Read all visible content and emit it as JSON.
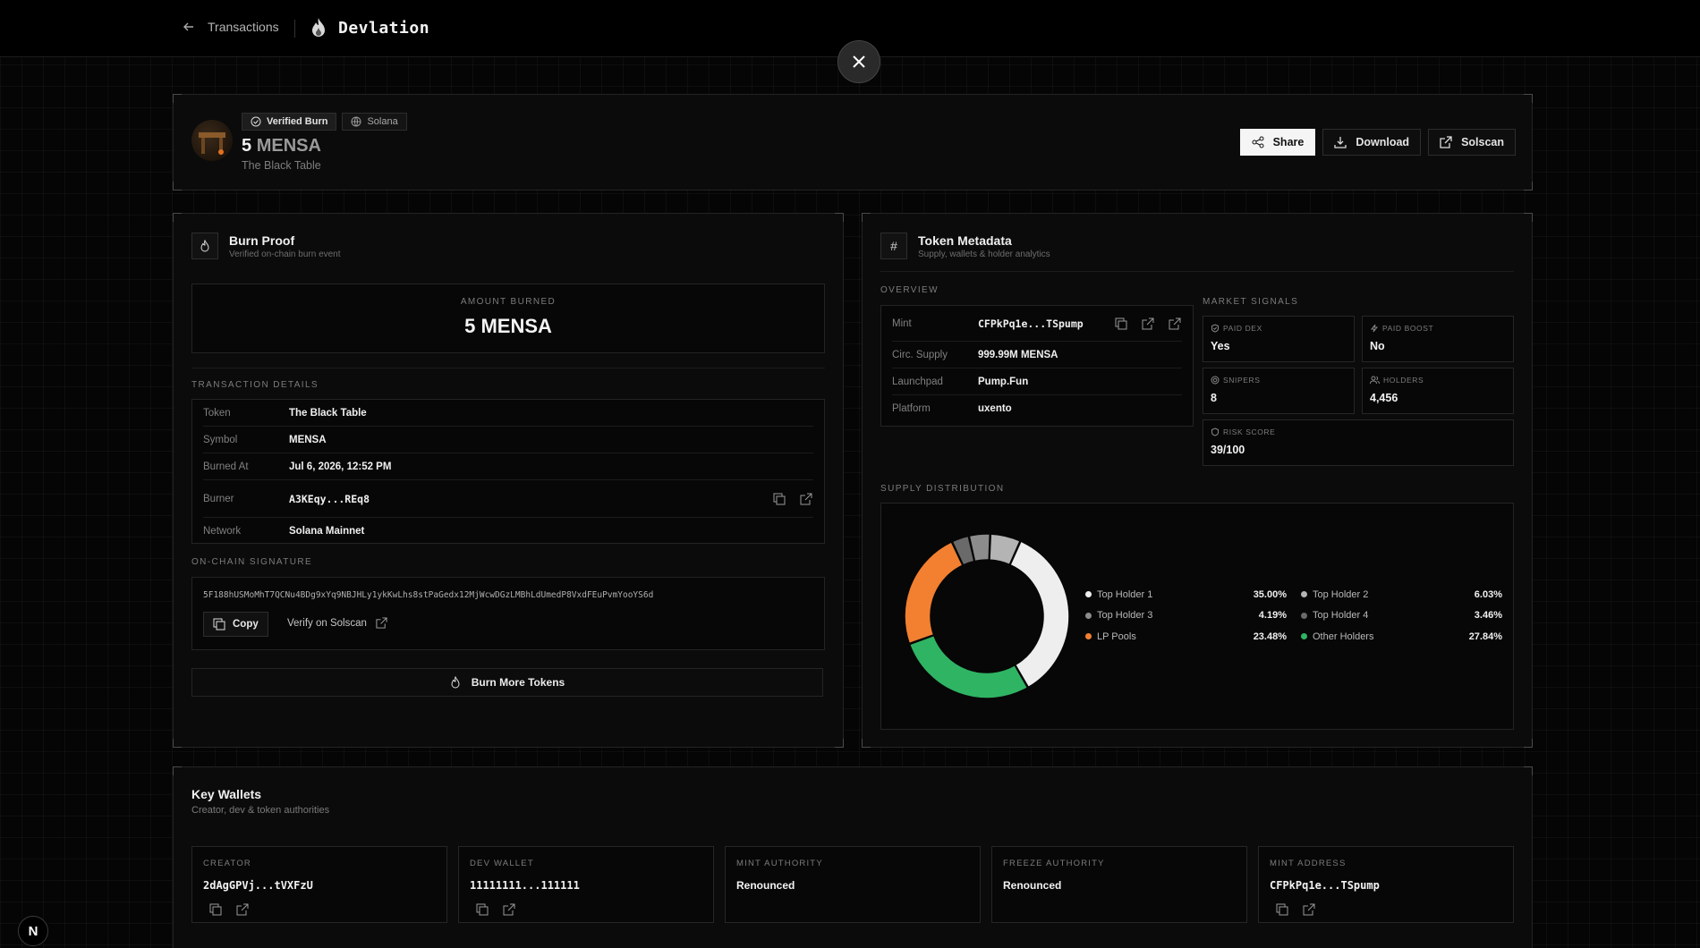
{
  "topbar": {
    "back_label": "Transactions",
    "brand": "Devlation"
  },
  "header": {
    "badge_verified": "Verified Burn",
    "badge_network": "Solana",
    "amount": "5",
    "symbol": "MENSA",
    "token_name": "The Black Table",
    "actions": {
      "share": "Share",
      "download": "Download",
      "solscan": "Solscan"
    }
  },
  "burn_proof": {
    "title": "Burn Proof",
    "subtitle": "Verified on-chain burn event",
    "amount_label": "AMOUNT BURNED",
    "amount_value": "5 MENSA",
    "tx_label": "TRANSACTION DETAILS",
    "rows": [
      {
        "k": "Token",
        "v": "The Black Table"
      },
      {
        "k": "Symbol",
        "v": "MENSA"
      },
      {
        "k": "Burned At",
        "v": "Jul 6, 2026, 12:52 PM"
      },
      {
        "k": "Burner",
        "v": "A3KEqy...REq8"
      },
      {
        "k": "Network",
        "v": "Solana Mainnet"
      }
    ],
    "signature_label": "ON-CHAIN SIGNATURE",
    "signature": "5F188hUSMoMhT7QCNu4BDg9xYq9NBJHLy1ykKwLhs8stPaGedx12MjWcwDGzLMBhLdUmedP8VxdFEuPvmYooYS6d",
    "copy_label": "Copy",
    "verify_label": "Verify on Solscan",
    "burn_more": "Burn More Tokens"
  },
  "metadata": {
    "title": "Token Metadata",
    "subtitle": "Supply, wallets & holder analytics",
    "overview_label": "OVERVIEW",
    "overview": [
      {
        "k": "Mint",
        "v": "CFPkPq1e...TSpump"
      },
      {
        "k": "Circ. Supply",
        "v": "999.99M MENSA"
      },
      {
        "k": "Launchpad",
        "v": "Pump.Fun"
      },
      {
        "k": "Platform",
        "v": "uxento"
      }
    ],
    "signals_label": "MARKET SIGNALS",
    "signals": {
      "paid_dex": {
        "label": "PAID DEX",
        "value": "Yes",
        "icon": "shield-check-icon"
      },
      "paid_boost": {
        "label": "PAID BOOST",
        "value": "No",
        "icon": "bolt-icon"
      },
      "snipers": {
        "label": "SNIPERS",
        "value": "8",
        "icon": "target-icon"
      },
      "holders": {
        "label": "HOLDERS",
        "value": "4,456",
        "icon": "users-icon"
      },
      "risk": {
        "label": "RISK SCORE",
        "value": "39/100",
        "icon": "shield-icon"
      }
    },
    "distribution_label": "SUPPLY DISTRIBUTION"
  },
  "chart_data": {
    "type": "pie",
    "donut": true,
    "categories": [
      "Top Holder 1",
      "Top Holder 2",
      "Top Holder 3",
      "Top Holder 4",
      "LP Pools",
      "Other Holders"
    ],
    "values": [
      35.0,
      6.03,
      4.19,
      3.46,
      23.48,
      27.84
    ],
    "labels": [
      "35.00%",
      "6.03%",
      "4.19%",
      "3.46%",
      "23.48%",
      "27.84%"
    ],
    "colors": [
      "#eeeeee",
      "#b4b4b4",
      "#8c8c8c",
      "#6a6a6a",
      "#f28030",
      "#2fb463"
    ],
    "legend": "right"
  },
  "wallets": {
    "title": "Key Wallets",
    "subtitle": "Creator, dev & token authorities",
    "cards": [
      {
        "label": "CREATOR",
        "value": "2dAgGPVj...tVXFzU",
        "mono": true,
        "icons": true
      },
      {
        "label": "DEV WALLET",
        "value": "11111111...111111",
        "mono": true,
        "icons": true
      },
      {
        "label": "MINT AUTHORITY",
        "value": "Renounced",
        "mono": false,
        "icons": false
      },
      {
        "label": "FREEZE AUTHORITY",
        "value": "Renounced",
        "mono": false,
        "icons": false
      },
      {
        "label": "MINT ADDRESS",
        "value": "CFPkPq1e...TSpump",
        "mono": true,
        "icons": true
      }
    ]
  },
  "dev_badge": "N"
}
